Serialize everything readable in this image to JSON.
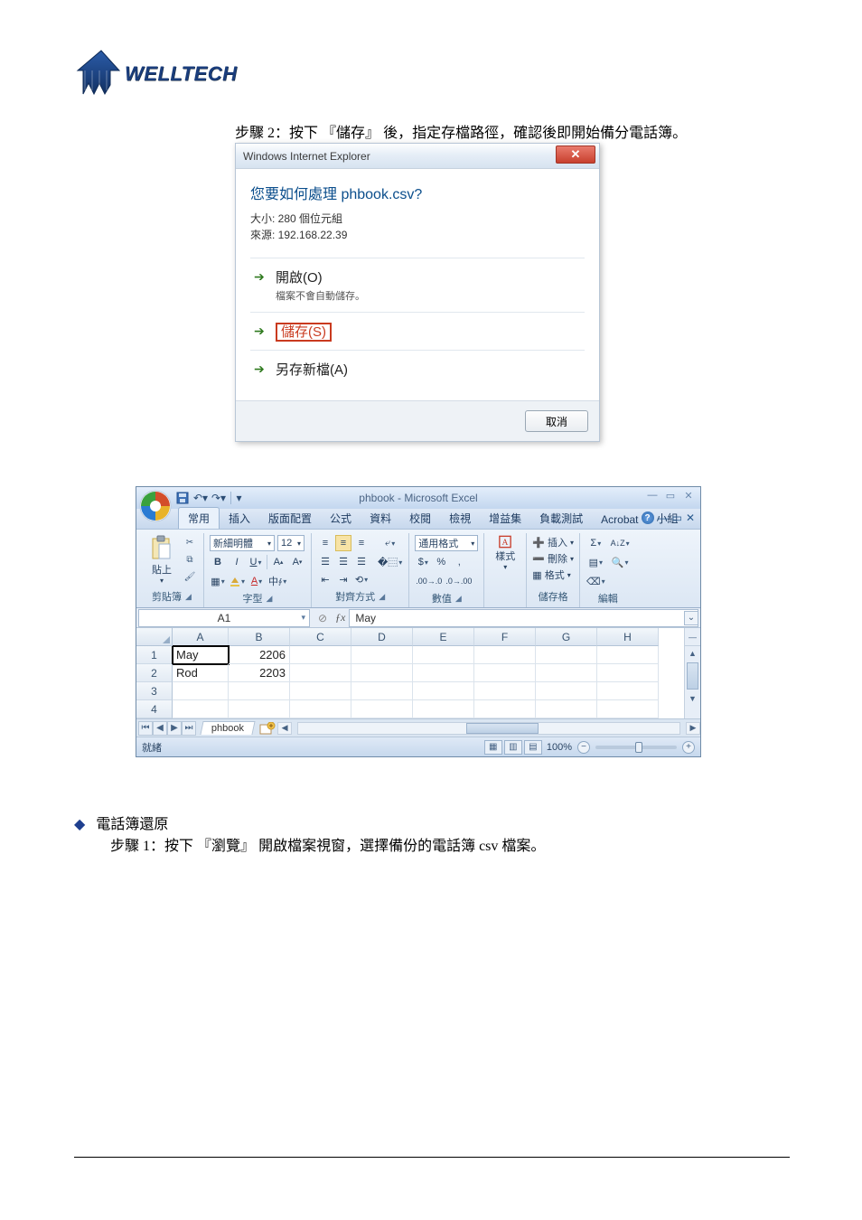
{
  "logo": {
    "text": "WELLTECH"
  },
  "step2_prefix": "步驟 2：按下",
  "step2_quoted": "儲存",
  "step2_suffix": "後，指定存檔路徑，確認後即開始備分電話簿。",
  "ie_dialog": {
    "title": "Windows Internet Explorer",
    "question": "您要如何處理 phbook.csv?",
    "size_line": "大小: 280 個位元組",
    "source_line": "來源: 192.168.22.39",
    "open_label": "開啟(O)",
    "open_sub": "檔案不會自動儲存。",
    "save_label": "儲存(S)",
    "saveas_label": "另存新檔(A)",
    "cancel": "取消"
  },
  "excel": {
    "title": "phbook - Microsoft Excel",
    "tabs": {
      "home": "常用",
      "insert": "插入",
      "layout": "版面配置",
      "formulas": "公式",
      "data": "資料",
      "review": "校閱",
      "view": "檢視",
      "addins": "增益集",
      "loadtest": "負載測試",
      "acrobat": "Acrobat",
      "team": "小組"
    },
    "groups": {
      "clipboard": "剪貼簿",
      "paste": "貼上",
      "font": "字型",
      "font_name": "新細明體",
      "font_size": "12",
      "alignment": "對齊方式",
      "number": "數值",
      "number_format": "通用格式",
      "styles": "樣式",
      "cells": "儲存格",
      "cells_insert": "插入",
      "cells_delete": "刪除",
      "cells_format": "格式",
      "editing": "編輯"
    },
    "name_box": "A1",
    "fx_value": "May",
    "columns": [
      "A",
      "B",
      "C",
      "D",
      "E",
      "F",
      "G",
      "H"
    ],
    "rows": [
      "1",
      "2",
      "3",
      "4"
    ],
    "cells": {
      "A1": "May",
      "B1": "2206",
      "A2": "Rod",
      "B2": "2203"
    },
    "sheet_tab": "phbook",
    "status_ready": "就緒",
    "zoom": "100%"
  },
  "bullet": {
    "heading": "電話簿還原",
    "sub_prefix": "步驟 1：按下",
    "sub_quoted": "瀏覽",
    "sub_suffix": "開啟檔案視窗，選擇備份的電話簿 csv 檔案。"
  }
}
